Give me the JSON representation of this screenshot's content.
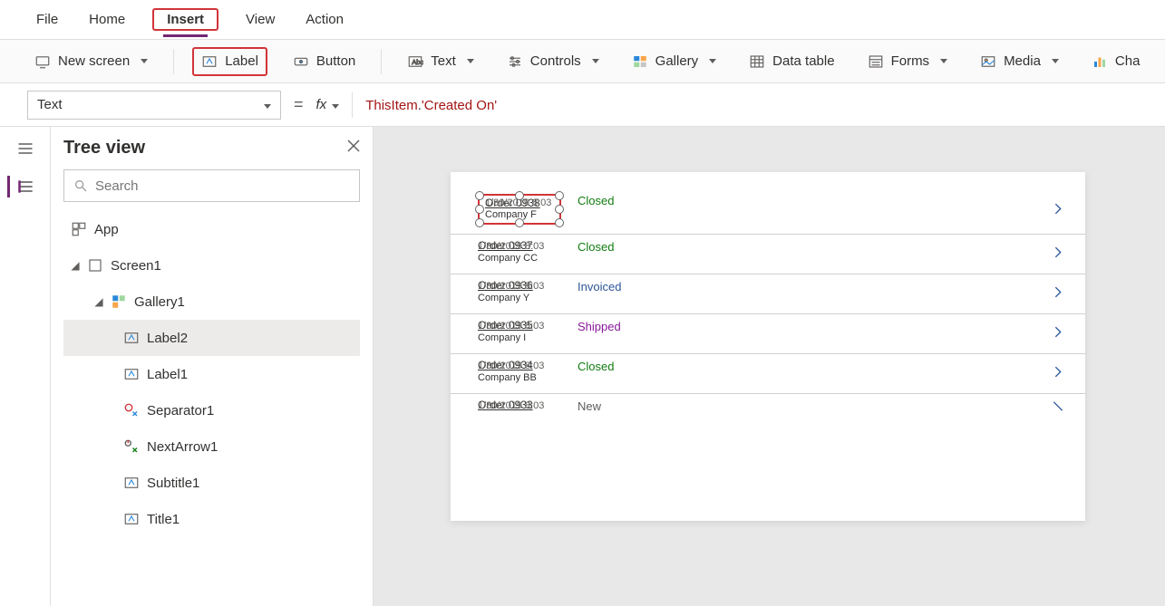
{
  "menubar": {
    "items": [
      "File",
      "Home",
      "Insert",
      "View",
      "Action"
    ],
    "active": "Insert"
  },
  "ribbon": {
    "new_screen": "New screen",
    "label": "Label",
    "button": "Button",
    "text": "Text",
    "controls": "Controls",
    "gallery": "Gallery",
    "data_table": "Data table",
    "forms": "Forms",
    "media": "Media",
    "chart": "Cha"
  },
  "formula": {
    "property": "Text",
    "equals": "=",
    "fx": "fx",
    "expr_obj": "ThisItem",
    "expr_dot": ".",
    "expr_field": "'Created On'"
  },
  "treeview": {
    "title": "Tree view",
    "search_placeholder": "Search",
    "nodes": {
      "app": "App",
      "screen1": "Screen1",
      "gallery1": "Gallery1",
      "label2": "Label2",
      "label1": "Label1",
      "separator1": "Separator1",
      "nextarrow1": "NextArrow1",
      "subtitle1": "Subtitle1",
      "title1": "Title1"
    }
  },
  "gallery_rows": [
    {
      "title": "Order 0938",
      "sub1": "1/30/2019 8:03",
      "sub2": "Company F",
      "status": "Closed",
      "cls": "s-closed",
      "selected": true
    },
    {
      "title": "Order 0937",
      "sub1": "1/30/2019 8:03",
      "sub2": "Company CC",
      "status": "Closed",
      "cls": "s-closed",
      "selected": false
    },
    {
      "title": "Order 0936",
      "sub1": "1/30/2019 8:03",
      "sub2": "Company Y",
      "status": "Invoiced",
      "cls": "s-invoiced",
      "selected": false
    },
    {
      "title": "Order 0935",
      "sub1": "1/30/2019 8:03",
      "sub2": "Company I",
      "status": "Shipped",
      "cls": "s-shipped",
      "selected": false
    },
    {
      "title": "Order 0934",
      "sub1": "1/30/2019 8:03",
      "sub2": "Company BB",
      "status": "Closed",
      "cls": "s-closed",
      "selected": false
    },
    {
      "title": "Order 0933",
      "sub1": "1/30/2019 8:03",
      "sub2": "",
      "status": "New",
      "cls": "s-new",
      "selected": false
    }
  ]
}
